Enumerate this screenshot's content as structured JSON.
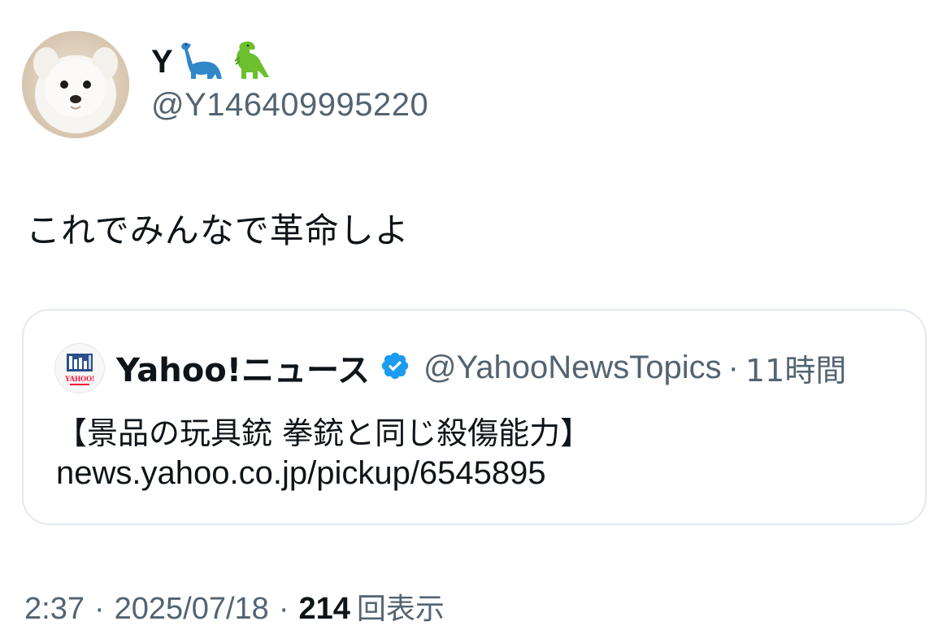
{
  "colors": {
    "text_primary": "#0f1419",
    "text_secondary": "#536471",
    "verified_blue": "#1d9bf0",
    "card_border": "#e3e8ec",
    "yahoo_red": "#ff0033"
  },
  "author": {
    "display_name": "Y",
    "emojis": [
      "sauropod-icon",
      "t-rex-icon"
    ],
    "handle": "@Y146409995220",
    "avatar": "white-puppy-avatar"
  },
  "tweet": {
    "text": "これでみんなで革命しよ"
  },
  "quote": {
    "avatar": "yahoo-news-logo",
    "avatar_text": "YAHOO!",
    "name": "Yahoo!ニュース",
    "verified_icon": "verified-badge-icon",
    "handle": "@YahooNewsTopics",
    "separator": "·",
    "time": "11時間",
    "title": "【景品の玩具銃 拳銃と同じ殺傷能力】",
    "link": "news.yahoo.co.jp/pickup/6545895"
  },
  "meta": {
    "time": "2:37",
    "sep1": "·",
    "date": "2025/07/18",
    "sep2": "·",
    "views_count": "214",
    "views_label": "回表示"
  }
}
